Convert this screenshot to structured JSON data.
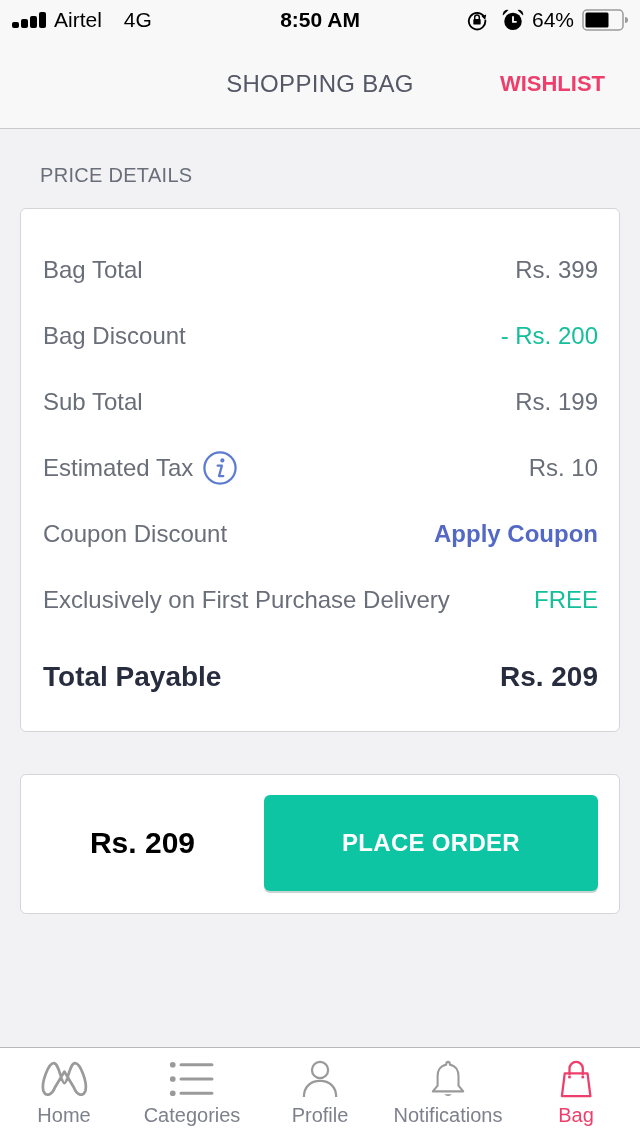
{
  "status_bar": {
    "carrier": "Airtel",
    "network": "4G",
    "time": "8:50 AM",
    "battery": "64%"
  },
  "header": {
    "title": "SHOPPING BAG",
    "action": "WISHLIST"
  },
  "price_details": {
    "heading": "PRICE DETAILS",
    "rows": [
      {
        "label": "Bag Total",
        "value": "Rs. 399",
        "kind": "plain",
        "info": false
      },
      {
        "label": "Bag Discount",
        "value": "- Rs. 200",
        "kind": "discount",
        "info": false
      },
      {
        "label": "Sub Total",
        "value": "Rs. 199",
        "kind": "plain",
        "info": false
      },
      {
        "label": "Estimated Tax",
        "value": "Rs. 10",
        "kind": "plain",
        "info": true
      },
      {
        "label": "Coupon Discount",
        "value": "Apply Coupon",
        "kind": "link",
        "info": false
      },
      {
        "label": "Exclusively on First Purchase Delivery",
        "value": "FREE",
        "kind": "free",
        "info": false
      }
    ],
    "total": {
      "label": "Total Payable",
      "value": "Rs. 209"
    }
  },
  "order_bar": {
    "amount": "Rs. 209",
    "button": "PLACE ORDER"
  },
  "tab_bar": [
    {
      "label": "Home",
      "selected": false
    },
    {
      "label": "Categories",
      "selected": false
    },
    {
      "label": "Profile",
      "selected": false
    },
    {
      "label": "Notifications",
      "selected": false
    },
    {
      "label": "Bag",
      "selected": true
    }
  ]
}
